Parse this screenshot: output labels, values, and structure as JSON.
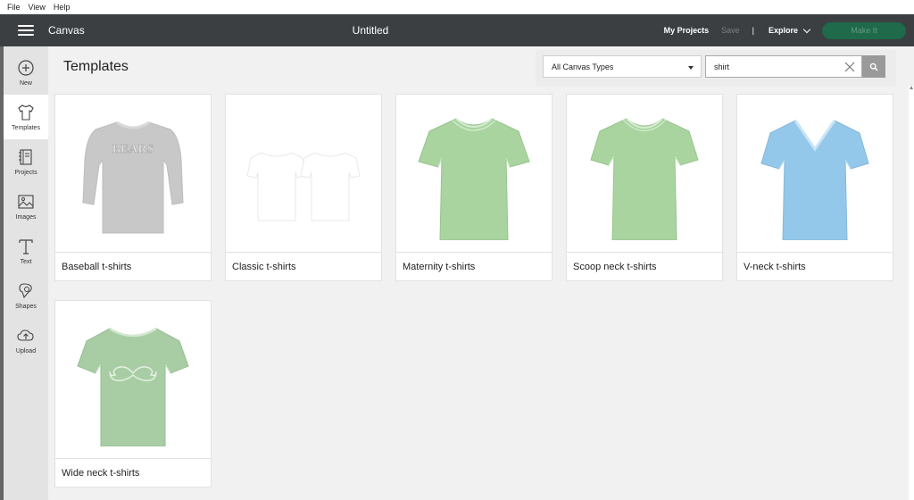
{
  "menubar": {
    "file": "File",
    "view": "View",
    "help": "Help"
  },
  "topbar": {
    "app_title": "Canvas",
    "doc_title": "Untitled",
    "my_projects": "My Projects",
    "save": "Save",
    "separator": "|",
    "explore": "Explore",
    "make_it": "Make It"
  },
  "sidebar": {
    "items": [
      {
        "label": "New",
        "icon": "plus-circle-icon"
      },
      {
        "label": "Templates",
        "icon": "tshirt-icon"
      },
      {
        "label": "Projects",
        "icon": "notebook-icon"
      },
      {
        "label": "Images",
        "icon": "image-icon"
      },
      {
        "label": "Text",
        "icon": "text-icon"
      },
      {
        "label": "Shapes",
        "icon": "shapes-icon"
      },
      {
        "label": "Upload",
        "icon": "cloud-upload-icon"
      }
    ],
    "active_index": 1
  },
  "page": {
    "title": "Templates"
  },
  "filter": {
    "canvas_type": "All Canvas Types"
  },
  "search": {
    "value": "shirt"
  },
  "templates": [
    {
      "label": "Baseball t-shirts",
      "color": "#c8c8c8",
      "graphic_text": "BEARS"
    },
    {
      "label": "Classic t-shirts",
      "color": "#ffffff"
    },
    {
      "label": "Maternity t-shirts",
      "color": "#a9d49f"
    },
    {
      "label": "Scoop neck t-shirts",
      "color": "#a9d49f"
    },
    {
      "label": "V-neck t-shirts",
      "color": "#94c8ea"
    },
    {
      "label": "Wide neck t-shirts",
      "color": "#a8cda4"
    }
  ],
  "colors": {
    "topbar": "#3b3f42",
    "make_it": "#1e6a4a"
  }
}
